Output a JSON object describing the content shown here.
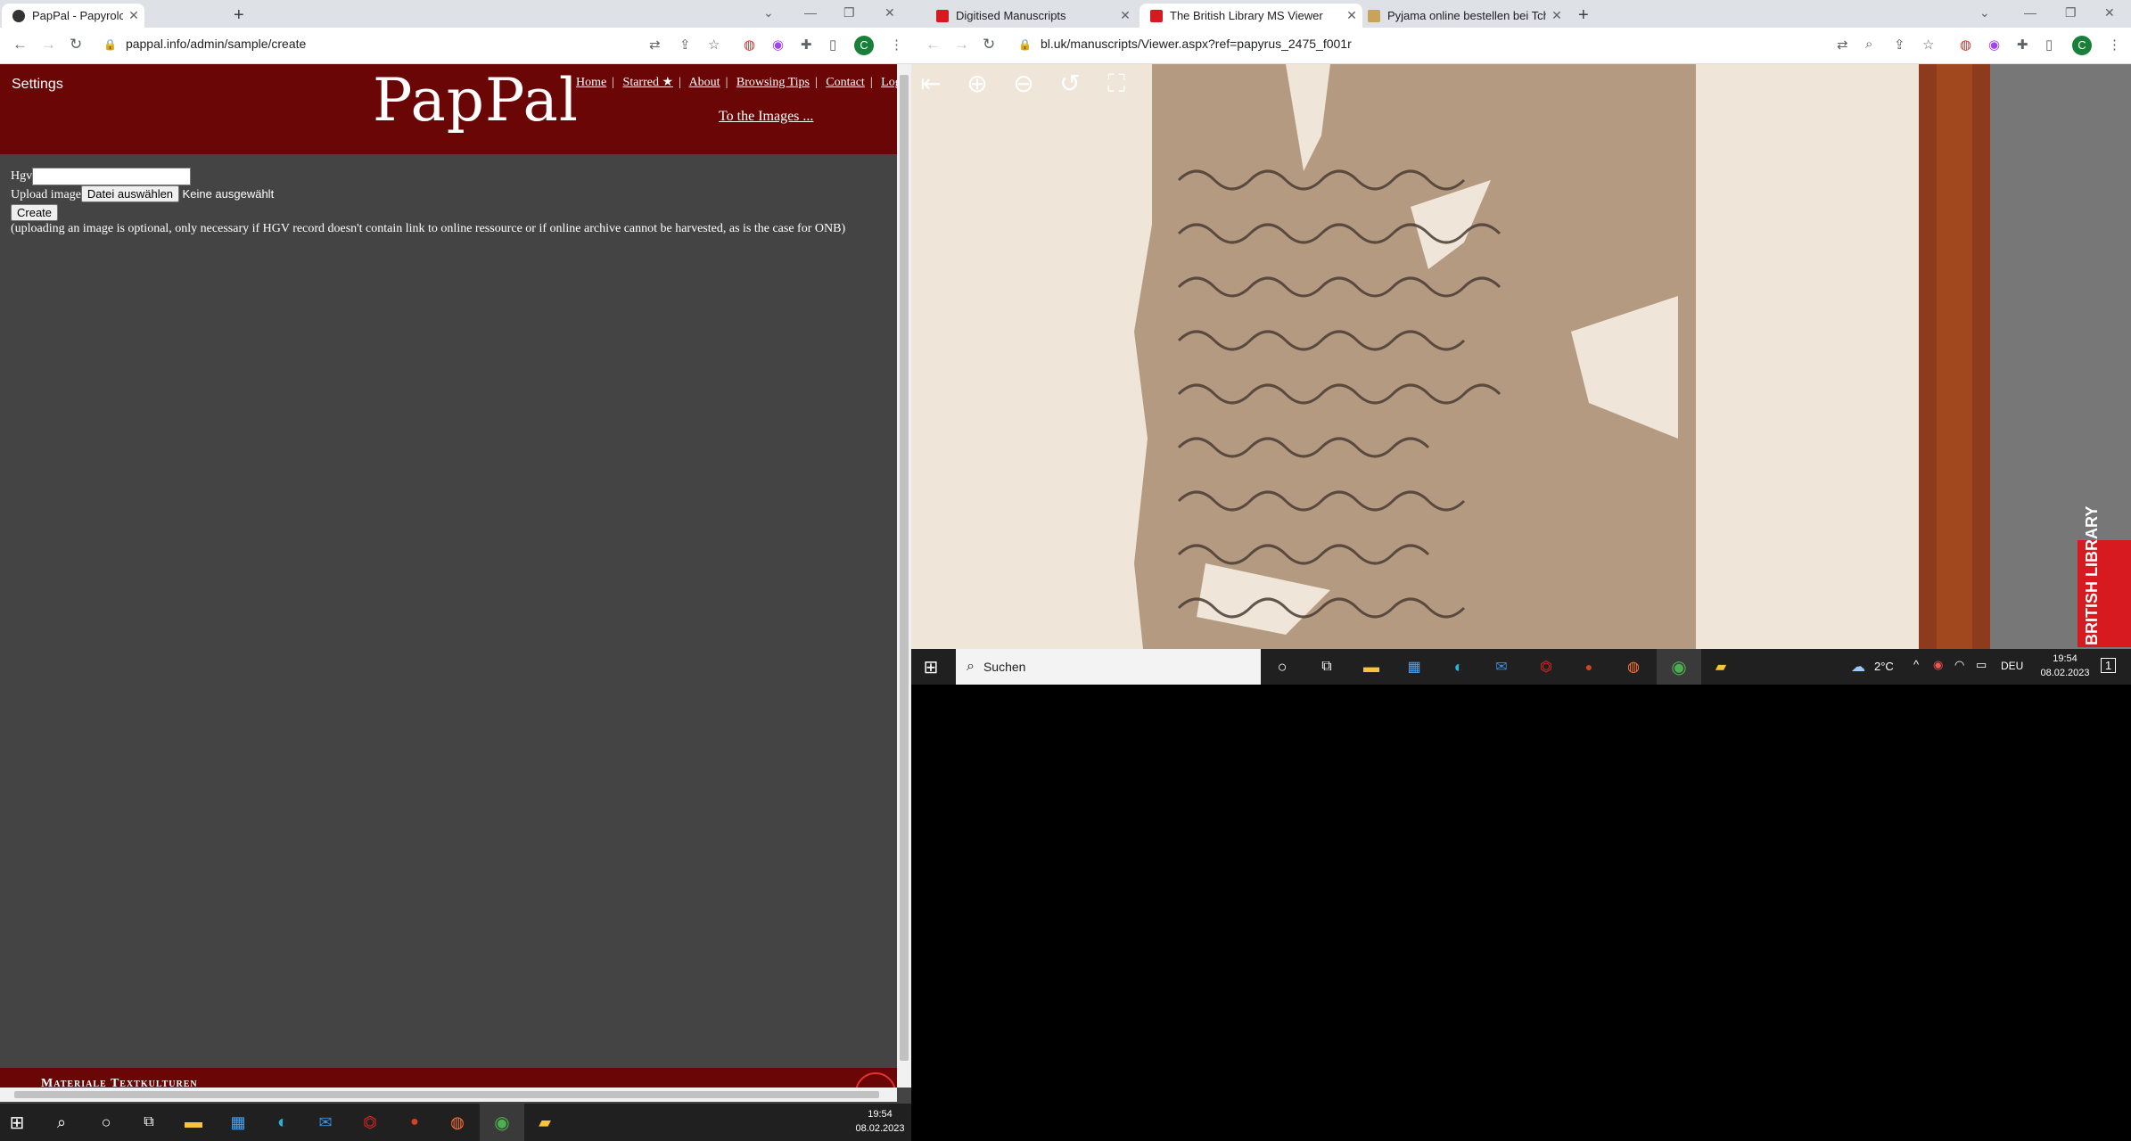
{
  "left_browser": {
    "tabs": [
      {
        "label": "PapPal - Papyrology | Paleograph",
        "active": true
      }
    ],
    "address": "pappal.info/admin/sample/create",
    "profile_initial": "C"
  },
  "pappal": {
    "settings": "Settings",
    "logo": "PapPal",
    "nav": [
      "Home",
      "Starred ★",
      "About",
      "Browsing Tips",
      "Contact",
      "Logou"
    ],
    "nav_sep": "|",
    "to_images": "To the Images ...",
    "form": {
      "hgv_label": "Hgv",
      "upload_label": "Upload image",
      "file_button": "Datei auswählen",
      "file_status": "Keine ausgewählt",
      "create_button": "Create",
      "note": "(uploading an image is optional, only necessary if HGV record doesn't contain link to online ressource or if online archive cannot be harvested, as is the case for ONB)"
    },
    "footer": "Materiale Textkulturen"
  },
  "left_taskbar": {
    "time": "19:54",
    "date": "08.02.2023"
  },
  "right_browser": {
    "tabs": [
      {
        "label": "Digitised Manuscripts",
        "active": false
      },
      {
        "label": "The British Library MS Viewer",
        "active": true
      },
      {
        "label": "Pyjama online bestellen bei Tchib",
        "active": false
      }
    ],
    "address": "bl.uk/manuscripts/Viewer.aspx?ref=papyrus_2475_f001r",
    "profile_initial": "C",
    "brand": "BRITISH LIBRARY"
  },
  "right_taskbar": {
    "search_placeholder": "Suchen",
    "weather": "2°C",
    "lang": "DEU",
    "time": "19:54",
    "date": "08.02.2023",
    "notif_count": "1"
  },
  "colors": {
    "pappal_red": "#6b0606",
    "page_bg": "#444444",
    "taskbar": "#202020",
    "bl_red": "#d71920"
  }
}
